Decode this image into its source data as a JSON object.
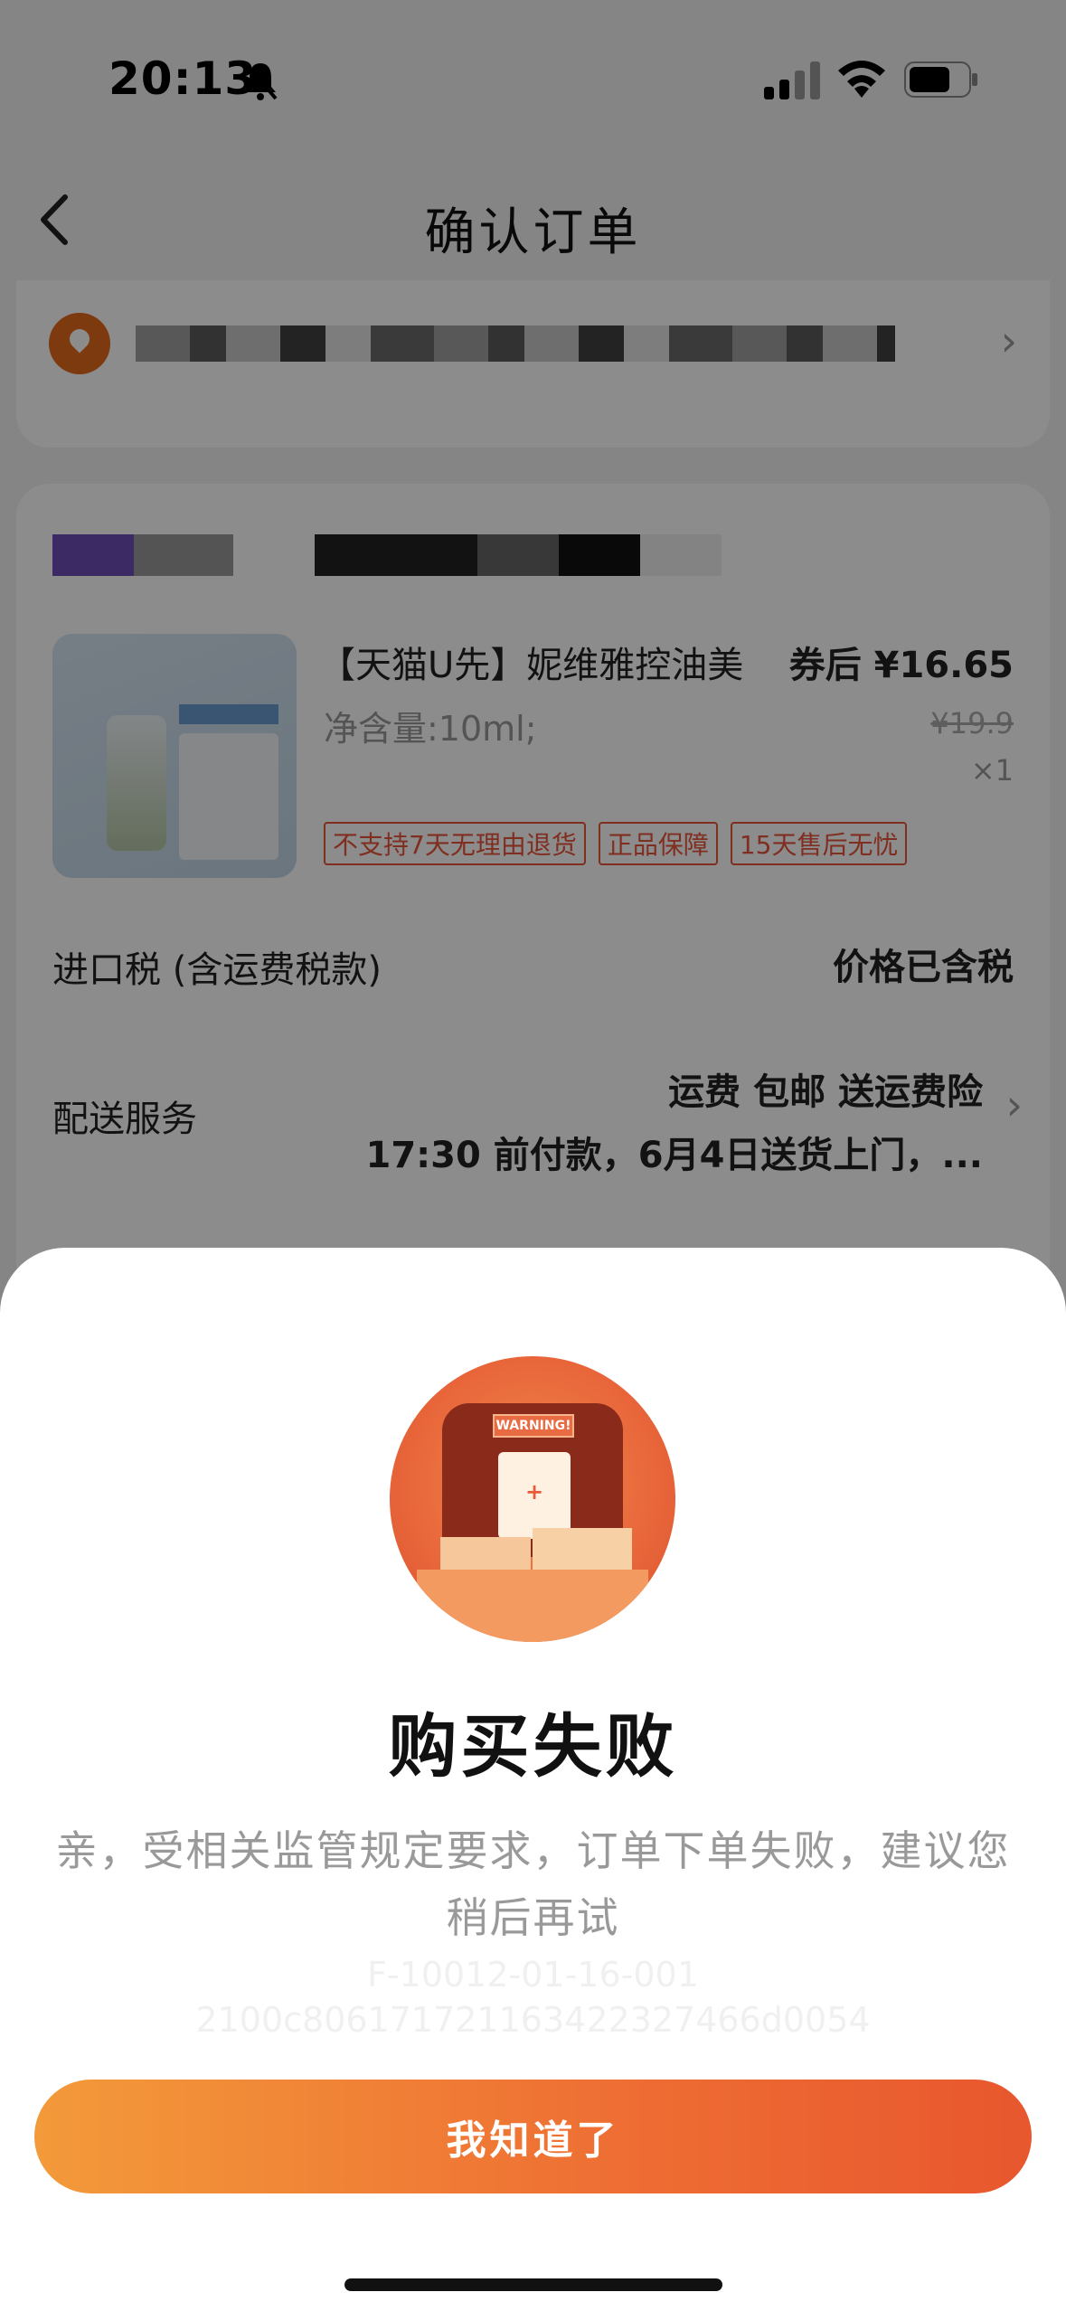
{
  "status_bar": {
    "time": "20:13"
  },
  "nav": {
    "title": "确认订单"
  },
  "product": {
    "title": "【天猫U先】妮维雅控油美",
    "price": "券后 ¥16.65",
    "spec": "净含量:10ml;",
    "original_price": "¥19.9",
    "quantity": "×1",
    "tags": [
      "不支持7天无理由退货",
      "正品保障",
      "15天售后无忧"
    ]
  },
  "tax_row": {
    "label": "进口税 (含运费税款)",
    "value": "价格已含税"
  },
  "shipping_row": {
    "label": "配送服务",
    "line1": "运费 包邮 送运费险",
    "line2": "17:30 前付款，6月4日送货上门，..."
  },
  "dialog": {
    "illustration_text": "WARNING!",
    "title": "购买失败",
    "message": "亲，受相关监管规定要求，订单下单失败，建议您稍后再试",
    "code_line1": "F-10012-01-16-001",
    "code_line2": "2100c806171721163422327466d0054",
    "button_label": "我知道了"
  },
  "colors": {
    "accent_start": "#f39a3a",
    "accent_end": "#e8572e",
    "tag_red": "#e8553a"
  }
}
